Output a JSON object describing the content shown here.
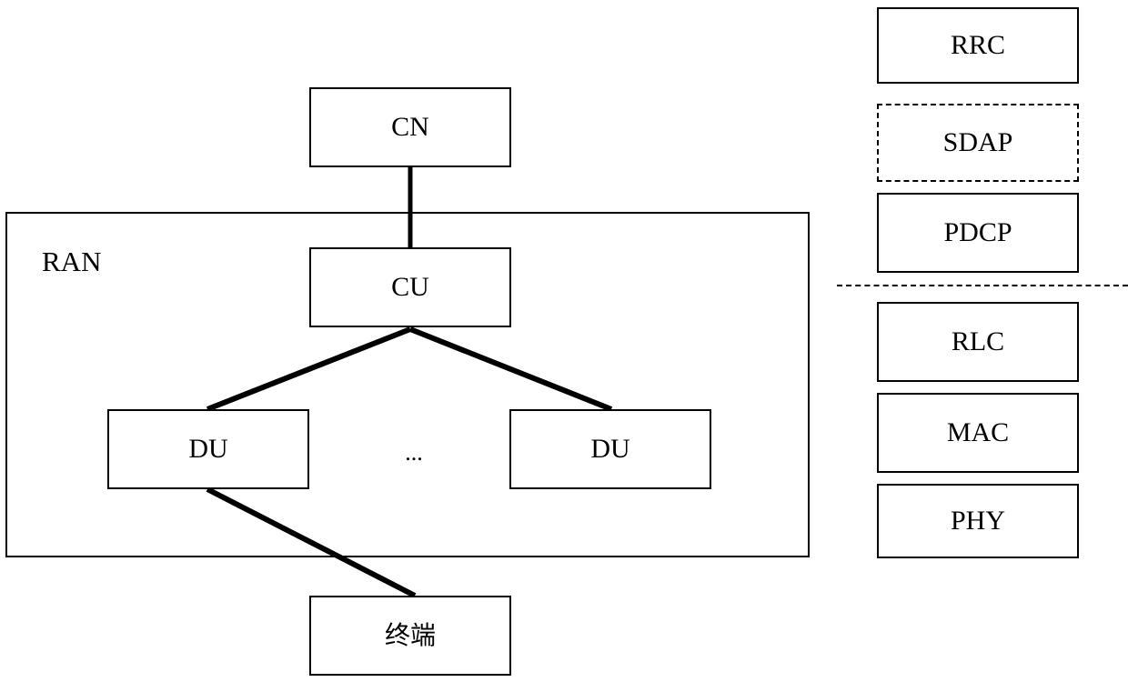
{
  "diagram": {
    "ran_container": {
      "label": "RAN"
    },
    "nodes": {
      "cn": "CN",
      "cu": "CU",
      "du_left": "DU",
      "du_right": "DU",
      "ellipsis": "...",
      "terminal": "终端"
    },
    "protocol_stack": {
      "upper_layers": [
        {
          "label": "RRC",
          "border": "solid"
        },
        {
          "label": "SDAP",
          "border": "dashed"
        },
        {
          "label": "PDCP",
          "border": "solid"
        }
      ],
      "lower_layers": [
        {
          "label": "RLC",
          "border": "solid"
        },
        {
          "label": "MAC",
          "border": "solid"
        },
        {
          "label": "PHY",
          "border": "solid"
        }
      ]
    },
    "colors": {
      "line": "#000000",
      "background": "#ffffff",
      "text": "#000000"
    }
  }
}
